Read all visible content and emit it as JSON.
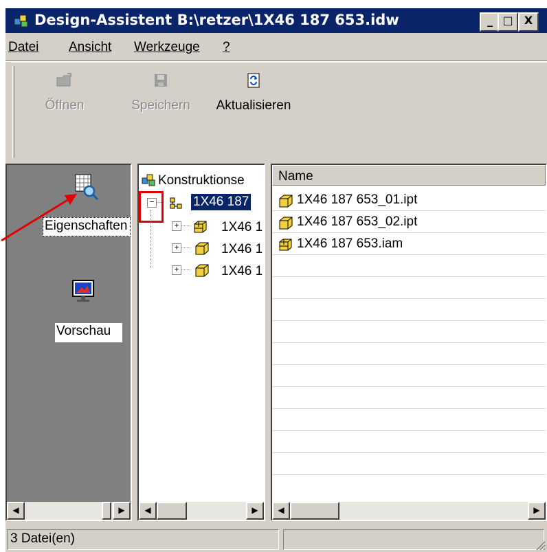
{
  "window": {
    "title": "Design-Assistent B:\\retzer\\1X46 187 653.idw",
    "minimize": "_",
    "maximize": "□",
    "close": "X"
  },
  "menu": {
    "file": "Datei",
    "view": "Ansicht",
    "tools": "Werkzeuge",
    "help": "?"
  },
  "toolbar": {
    "open": "Öffnen",
    "save": "Speichern",
    "refresh": "Aktualisieren"
  },
  "sidebar": {
    "properties": "Eigenschaften",
    "preview": "Vorschau"
  },
  "tree": {
    "root": "Konstruktionse",
    "selected": "1X46 187",
    "children": [
      "1X46 1",
      "1X46 1",
      "1X46 1"
    ]
  },
  "list": {
    "header": "Name",
    "items": [
      {
        "name": "1X46 187 653_01.ipt",
        "icon": "part-icon"
      },
      {
        "name": "1X46 187 653_02.ipt",
        "icon": "part-icon"
      },
      {
        "name": "1X46 187 653.iam",
        "icon": "assembly-icon"
      }
    ]
  },
  "status": {
    "files": "3 Datei(en)"
  },
  "colors": {
    "titlebar": "#0a246a",
    "selection": "#0a246a",
    "annotation": "#e00000"
  }
}
